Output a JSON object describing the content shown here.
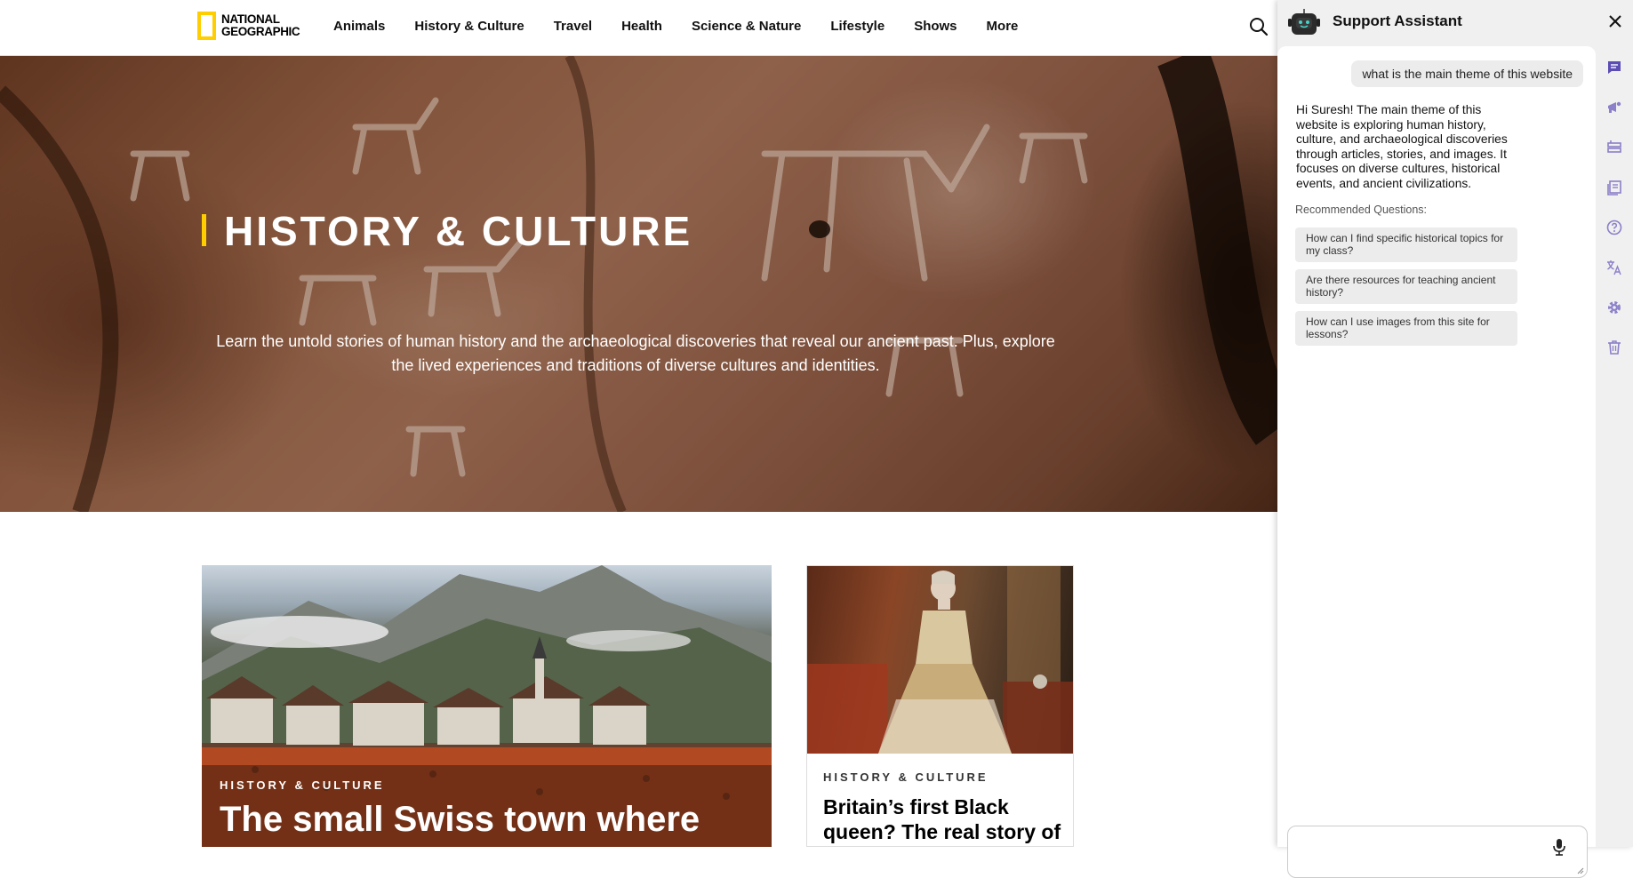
{
  "nav": {
    "logo": {
      "line1": "NATIONAL",
      "line2": "GEOGRAPHIC"
    },
    "links": [
      "Animals",
      "History & Culture",
      "Travel",
      "Health",
      "Science & Nature",
      "Lifestyle",
      "Shows",
      "More"
    ],
    "search_icon": "search-icon"
  },
  "hero": {
    "title": "HISTORY & CULTURE",
    "description": "Learn the untold stories of human history and the archaeological discoveries that reveal our ancient past. Plus, explore the lived experiences and traditions of diverse cultures and identities."
  },
  "cards": {
    "main": {
      "kicker": "HISTORY & CULTURE",
      "title": "The small Swiss town where"
    },
    "side": {
      "kicker": "HISTORY & CULTURE",
      "title": "Britain’s first Black queen? The real story of"
    }
  },
  "chat": {
    "title": "Support Assistant",
    "user_message": "what is the main theme of this website",
    "bot_message": "Hi Suresh! The main theme of this website is exploring human history, culture, and archaeological discoveries through articles, stories, and images. It focuses on diverse cultures, historical events, and ancient civilizations.",
    "recommended_label": "Recommended Questions:",
    "recommended": [
      "How can I find specific historical topics for my class?",
      "Are there resources for teaching ancient history?",
      "How can I use images from this site for lessons?"
    ],
    "input_value": "",
    "rail_icons": [
      "chat-icon",
      "megaphone-icon",
      "layout-icon",
      "library-icon",
      "help-icon",
      "translate-icon",
      "settings-icon",
      "trash-icon"
    ]
  },
  "colors": {
    "brand_yellow": "#ffce00",
    "chat_accent": "#5b4db3"
  }
}
